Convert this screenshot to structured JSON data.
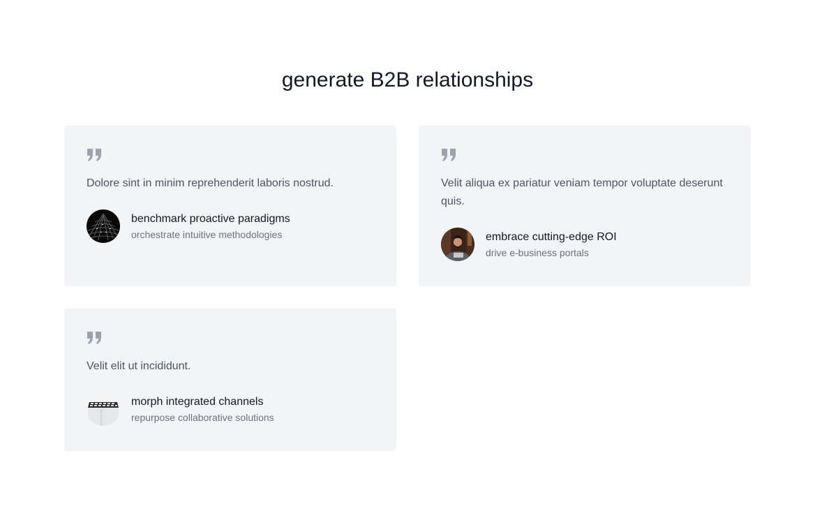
{
  "section": {
    "title": "generate B2B relationships"
  },
  "testimonials": [
    {
      "quote": "Dolore sint in minim reprehenderit laboris nostrud.",
      "name": "benchmark proactive paradigms",
      "role": "orchestrate intuitive methodologies",
      "avatar": "keyboard-photo-avatar"
    },
    {
      "quote": "Velit aliqua ex pariatur veniam tempor voluptate deserunt quis.",
      "name": "embrace cutting-edge ROI",
      "role": "drive e-business portals",
      "avatar": "person-photo-avatar"
    },
    {
      "quote": "Velit elit ut incididunt.",
      "name": "morph integrated channels",
      "role": "repurpose collaborative solutions",
      "avatar": "laptop-photo-avatar"
    }
  ],
  "colors": {
    "card_bg": "#f3f4f6",
    "heading": "#111827",
    "body_text": "#4b5563",
    "muted_text": "#6b7280",
    "quote_icon": "#9ca3af"
  }
}
